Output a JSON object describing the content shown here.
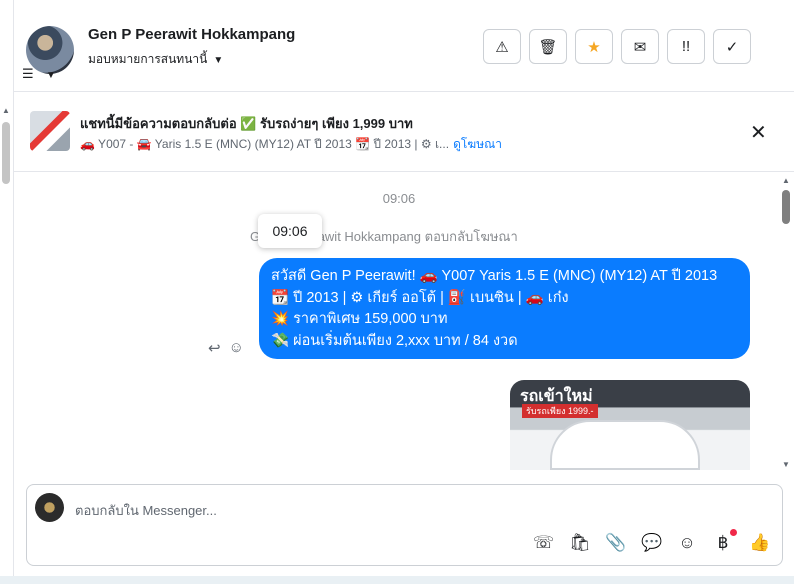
{
  "contact": {
    "name": "Gen P Peerawit Hokkampang",
    "assignment": "มอบหมายการสนทนานี้"
  },
  "actions": [
    {
      "icon": "alert-icon",
      "glyph": "⚠"
    },
    {
      "icon": "trash-icon",
      "glyph": "🗑"
    },
    {
      "icon": "star-icon",
      "glyph": "★"
    },
    {
      "icon": "mail-icon",
      "glyph": "✉"
    },
    {
      "icon": "priority-icon",
      "glyph": "!!"
    },
    {
      "icon": "check-icon",
      "glyph": "✓"
    }
  ],
  "ad": {
    "title": "แชทนี้มีข้อความตอบกลับต่อ ✅ รับรถง่ายๆ เพียง 1,999 บาท",
    "subtitle": "🚗 Y007 - 🚘 Yaris 1.5 E (MNC) (MY12) AT ปี 2013 📆 ปี 2013 | ⚙ เ...",
    "link": "ดูโฆษณา"
  },
  "chat": {
    "time_header": "09:06",
    "reply_note": "Gen P Peerawit Hokkampang ตอบกลับโฆษณา",
    "tooltip_time": "09:06",
    "message_lines": [
      "สวัสดี Gen P Peerawit! 🚗 Y007 Yaris 1.5 E (MNC) (MY12) AT ปี 2013",
      "📆 ปี 2013 | ⚙ เกียร์ ออโต้ | ⛽ เบนซิน | 🚗 เก๋ง",
      "💥 ราคาพิเศษ 159,000 บาท",
      "💸 ผ่อนเริ่มต้นเพียง 2,xxx บาท / 84 งวด"
    ],
    "image_title": "รถเข้าใหม่",
    "image_subtitle": "รับรถเพียง 1999.-"
  },
  "composer": {
    "placeholder": "ตอบกลับใน Messenger...",
    "tools": [
      {
        "icon": "call-add-icon",
        "glyph": "☏"
      },
      {
        "icon": "bag-icon",
        "glyph": "🛍"
      },
      {
        "icon": "attach-icon",
        "glyph": "📎"
      },
      {
        "icon": "chat-bubble-icon",
        "glyph": "💬"
      },
      {
        "icon": "emoji-icon",
        "glyph": "☺"
      },
      {
        "icon": "baht-icon",
        "glyph": "฿"
      },
      {
        "icon": "thumbs-up-icon",
        "glyph": "👍"
      }
    ]
  },
  "colors": {
    "bubble": "#0a7cff",
    "star": "#f5a623",
    "notification_dot": "#f02849"
  }
}
